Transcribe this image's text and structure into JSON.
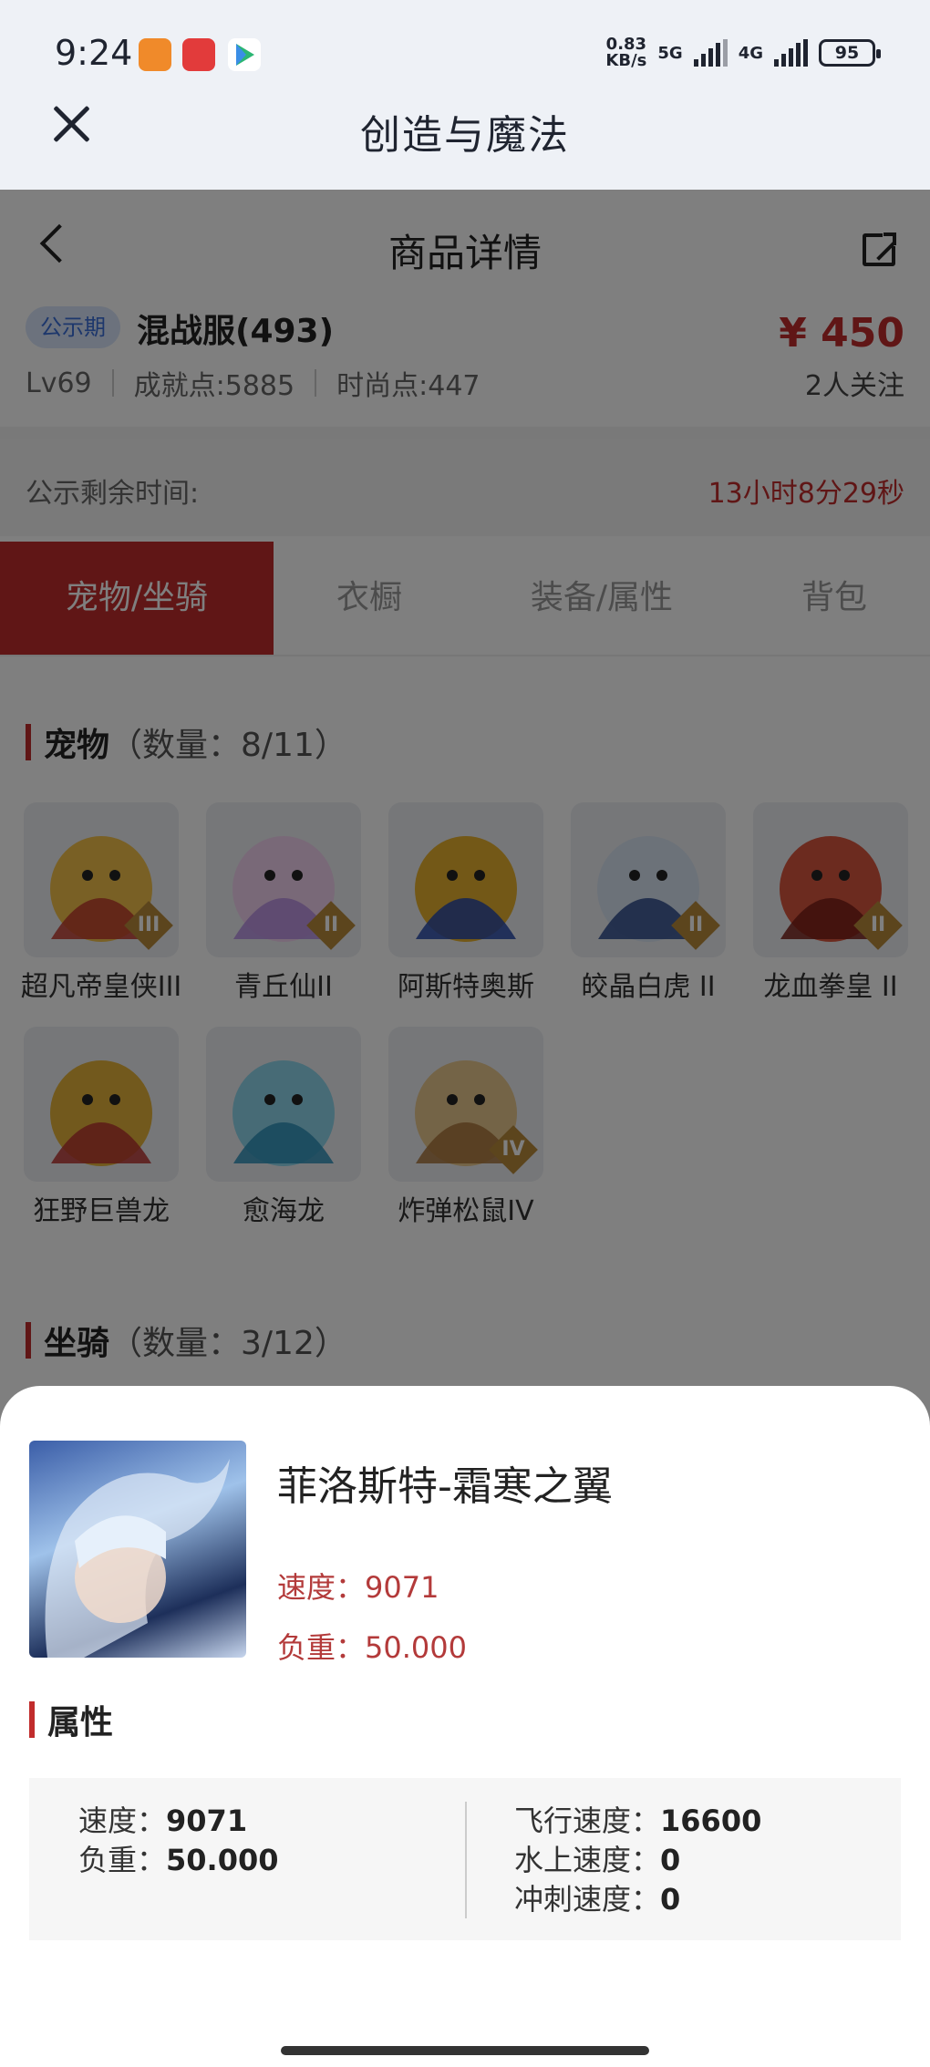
{
  "status_bar": {
    "time": "9:24",
    "speed": "0.83",
    "speed_unit": "KB/s",
    "net1": "5G",
    "net2": "4G",
    "battery": "95"
  },
  "webview": {
    "title": "创造与魔法"
  },
  "nav": {
    "title": "商品详情"
  },
  "listing": {
    "badge": "公示期",
    "server": "混战服(493)",
    "price": "¥ 450",
    "level": "Lv69",
    "achievement": "成就点:5885",
    "fashion": "时尚点:447",
    "followers": "2人关注",
    "notice_label": "公示剩余时间:",
    "notice_time": "13小时8分29秒"
  },
  "tabs": [
    {
      "label": "宠物/坐骑"
    },
    {
      "label": "衣橱"
    },
    {
      "label": "装备/属性"
    },
    {
      "label": "背包"
    }
  ],
  "pets_section": {
    "title": "宠物",
    "count": "（数量：8/11）"
  },
  "pets": [
    {
      "name": "超凡帝皇侠III",
      "tier": "III",
      "colors": [
        "#f2c14b",
        "#c0392b"
      ]
    },
    {
      "name": "青丘仙II",
      "tier": "II",
      "colors": [
        "#f3d3f1",
        "#b48be0"
      ]
    },
    {
      "name": "阿斯特奥斯",
      "tier": "",
      "colors": [
        "#e6b12f",
        "#2447a8"
      ]
    },
    {
      "name": "皎晶白虎 II",
      "tier": "II",
      "colors": [
        "#d9e4f2",
        "#2c4a8c"
      ]
    },
    {
      "name": "龙血拳皇 II",
      "tier": "II",
      "colors": [
        "#d8563f",
        "#7a1e16"
      ]
    },
    {
      "name": "狂野巨兽龙",
      "tier": "",
      "colors": [
        "#e4b33b",
        "#b8332f"
      ]
    },
    {
      "name": "愈海龙",
      "tier": "",
      "colors": [
        "#8fd7ec",
        "#2d8fb8"
      ]
    },
    {
      "name": "炸弹松鼠IV",
      "tier": "IV",
      "colors": [
        "#e9c88e",
        "#a8743b"
      ]
    }
  ],
  "mounts_section": {
    "title": "坐骑",
    "count": "（数量：3/12）"
  },
  "sheet": {
    "name": "菲洛斯特-霜寒之翼",
    "speed_line": "速度：9071",
    "load_line": "负重：50.000",
    "attr_title": "属性",
    "attrs_left": [
      {
        "label": "速度：",
        "value": "9071"
      },
      {
        "label": "负重：",
        "value": "50.000"
      }
    ],
    "attrs_right": [
      {
        "label": "飞行速度：",
        "value": "16600"
      },
      {
        "label": "水上速度：",
        "value": "0"
      },
      {
        "label": "冲刺速度：",
        "value": "0"
      }
    ]
  }
}
